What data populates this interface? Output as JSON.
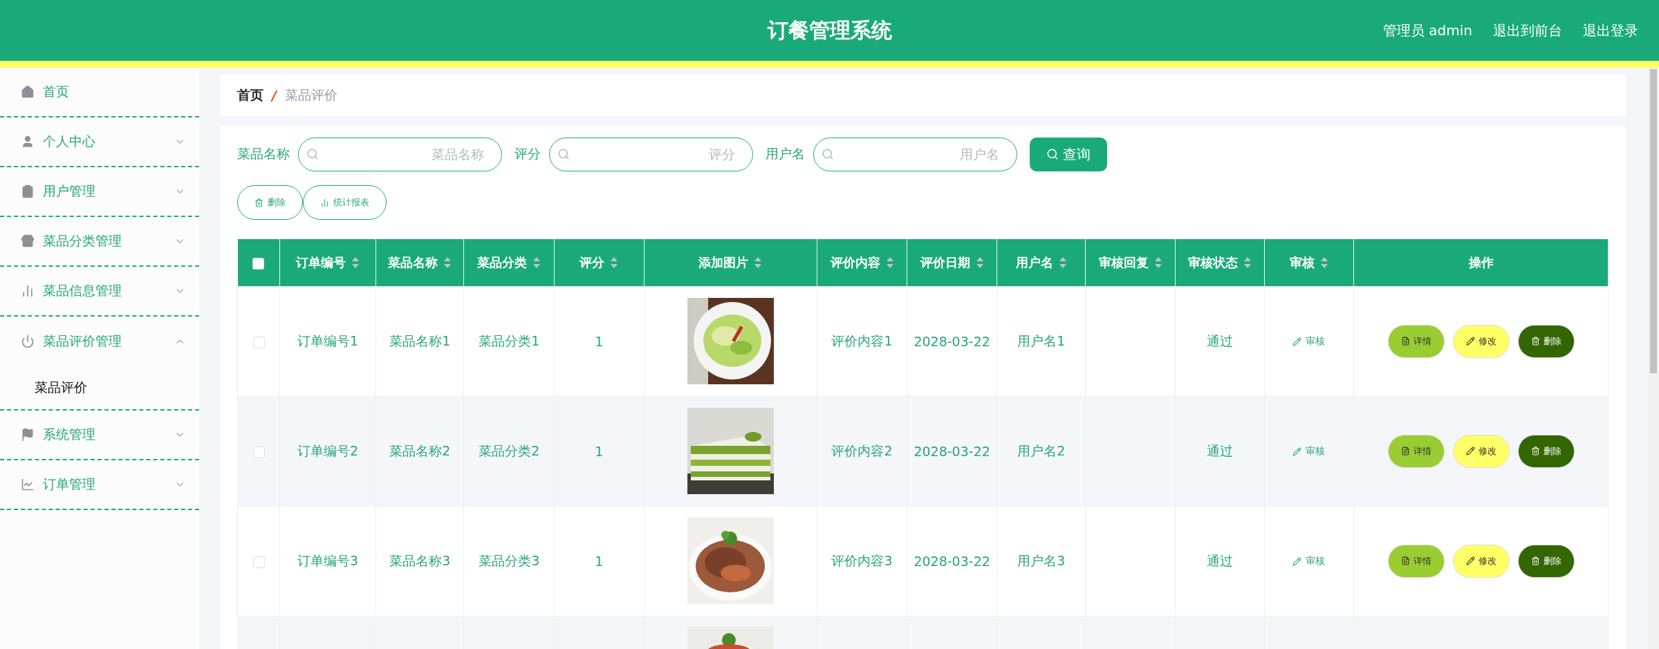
{
  "header": {
    "title": "订餐管理系统",
    "links": [
      "管理员 admin",
      "退出到前台",
      "退出登录"
    ]
  },
  "sidebar": {
    "items": [
      {
        "label": "首页",
        "kind": "link"
      },
      {
        "label": "个人中心",
        "kind": "submenu",
        "expanded": false
      },
      {
        "label": "用户管理",
        "kind": "submenu",
        "expanded": false
      },
      {
        "label": "菜品分类管理",
        "kind": "submenu",
        "expanded": false
      },
      {
        "label": "菜品信息管理",
        "kind": "submenu",
        "expanded": false
      },
      {
        "label": "菜品评价管理",
        "kind": "submenu",
        "expanded": true,
        "children": [
          {
            "label": "菜品评价",
            "selected": true
          }
        ]
      },
      {
        "label": "系统管理",
        "kind": "submenu",
        "expanded": false
      },
      {
        "label": "订单管理",
        "kind": "submenu",
        "expanded": false
      }
    ]
  },
  "breadcrumb": {
    "items": [
      "首页",
      "菜品评价"
    ],
    "separator": "/"
  },
  "search": {
    "fields": [
      {
        "label": "菜品名称",
        "placeholder": "菜品名称"
      },
      {
        "label": "评分",
        "placeholder": "评分"
      },
      {
        "label": "用户名",
        "placeholder": "用户名"
      }
    ],
    "button": "查询"
  },
  "actions": [
    "删除",
    "统计报表"
  ],
  "table": {
    "select_all": {
      "checked": false
    },
    "columns": [
      {
        "label": "订单编号",
        "sortable": true
      },
      {
        "label": "菜品名称",
        "sortable": true
      },
      {
        "label": "菜品分类",
        "sortable": true
      },
      {
        "label": "评分",
        "sortable": true
      },
      {
        "label": "添加图片",
        "sortable": true
      },
      {
        "label": "评价内容",
        "sortable": true
      },
      {
        "label": "评价日期",
        "sortable": true
      },
      {
        "label": "用户名",
        "sortable": true
      },
      {
        "label": "审核回复",
        "sortable": true
      },
      {
        "label": "审核状态",
        "sortable": true
      },
      {
        "label": "审核",
        "sortable": true
      },
      {
        "label": "操作",
        "sortable": false
      }
    ],
    "rows": [
      {
        "checked": false,
        "cells": [
          "订单编号1",
          "菜品名称1",
          "菜品分类1",
          "1"
        ],
        "image": {
          "kind": "picture"
        },
        "content": "评价内容1",
        "date": "2028-03-22",
        "user": "用户名1",
        "status": "通过",
        "audit": "审核",
        "buttons": [
          "详情",
          "修改",
          "删除"
        ]
      },
      {
        "checked": false,
        "cells": [
          "订单编号2",
          "菜品名称2",
          "菜品分类2",
          "1"
        ],
        "image": {
          "kind": "picture"
        },
        "content": "评价内容2",
        "date": "2028-03-22",
        "user": "用户名2",
        "status": "通过",
        "audit": "审核",
        "buttons": [
          "详情",
          "修改",
          "删除"
        ]
      },
      {
        "checked": false,
        "cells": [
          "订单编号3",
          "菜品名称3",
          "菜品分类3",
          "1"
        ],
        "image": {
          "kind": "picture"
        },
        "content": "评价内容3",
        "date": "2028-03-22",
        "user": "用户名3",
        "status": "通过",
        "audit": "审核",
        "buttons": [
          "详情",
          "修改",
          "删除"
        ]
      },
      {
        "image": {
          "kind": "picture"
        }
      }
    ]
  }
}
